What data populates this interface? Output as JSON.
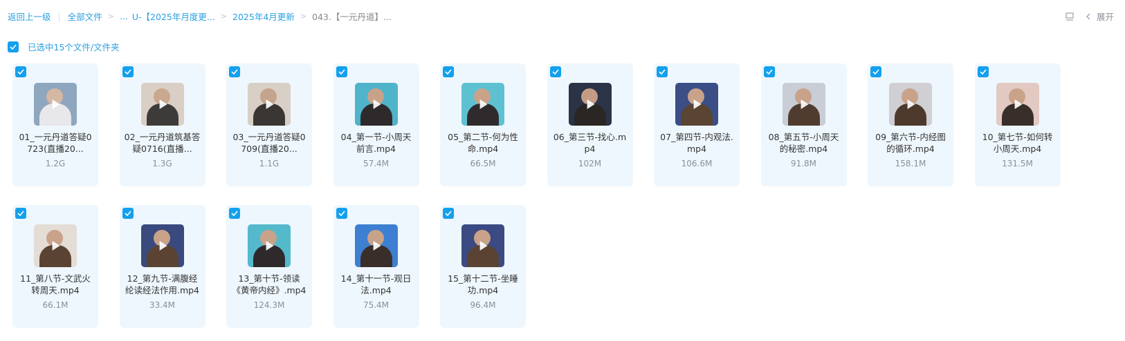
{
  "breadcrumb": {
    "back": "返回上一级",
    "all_files": "全部文件",
    "ellipsis": "...",
    "folder1": "U-【2025年月度更...",
    "folder2": "2025年4月更新",
    "current": "043.【一元丹道】..."
  },
  "toolbar": {
    "expand": "展开",
    "view_icon": "list-view-icon"
  },
  "selection": {
    "label": "已选中15个文件/文件夹"
  },
  "files": [
    {
      "name": "01_一元丹道答疑0723(直播20...",
      "size": "1.2G",
      "bg": "#8fa6bf",
      "body": "#e8e8ea",
      "face": "#d4b8a4"
    },
    {
      "name": "02_一元丹道筑基答疑0716(直播...",
      "size": "1.3G",
      "bg": "#d9cfc4",
      "body": "#3d3b3a",
      "face": "#c9a88f"
    },
    {
      "name": "03_一元丹道答疑0709(直播20...",
      "size": "1.1G",
      "bg": "#d8d0c6",
      "body": "#3a3634",
      "face": "#c4a48c"
    },
    {
      "name": "04_第一节-小周天前言.mp4",
      "size": "57.4M",
      "bg": "#4fb3c9",
      "body": "#2e2a2c",
      "face": "#c9a28a"
    },
    {
      "name": "05_第二节-何为性命.mp4",
      "size": "66.5M",
      "bg": "#5ec1d2",
      "body": "#2f2b2d",
      "face": "#c9a28a"
    },
    {
      "name": "06_第三节-找心.mp4",
      "size": "102M",
      "bg": "#2b3346",
      "body": "#2a2624",
      "face": "#c49c84"
    },
    {
      "name": "07_第四节-内观法.mp4",
      "size": "106.6M",
      "bg": "#3b4f86",
      "body": "#5a4432",
      "face": "#c9a28a"
    },
    {
      "name": "08_第五节-小周天的秘密.mp4",
      "size": "91.8M",
      "bg": "#c8cdd6",
      "body": "#4f3c2e",
      "face": "#c9a28a"
    },
    {
      "name": "09_第六节-内经图的循环.mp4",
      "size": "158.1M",
      "bg": "#cfcfd4",
      "body": "#4d3a2c",
      "face": "#c9a28a"
    },
    {
      "name": "10_第七节-如何转小周天.mp4",
      "size": "131.5M",
      "bg": "#e2c9c2",
      "body": "#3a2e2a",
      "face": "#c9a28a"
    },
    {
      "name": "11_第八节-文武火转周天.mp4",
      "size": "66.1M",
      "bg": "#e4ddd6",
      "body": "#5a4332",
      "face": "#c9a28a"
    },
    {
      "name": "12_第九节-满腹经纶读经法作用.mp4",
      "size": "33.4M",
      "bg": "#3a4a7e",
      "body": "#5a4332",
      "face": "#c9a28a"
    },
    {
      "name": "13_第十节-领读《黄帝内经》.mp4",
      "size": "124.3M",
      "bg": "#55b9cc",
      "body": "#2e2a2c",
      "face": "#c9a28a"
    },
    {
      "name": "14_第十一节-观日法.mp4",
      "size": "75.4M",
      "bg": "#3d7fd0",
      "body": "#3a2e2a",
      "face": "#c9a28a"
    },
    {
      "name": "15_第十二节-坐睡功.mp4",
      "size": "96.4M",
      "bg": "#3b4a82",
      "body": "#5a4332",
      "face": "#c9a28a"
    }
  ]
}
